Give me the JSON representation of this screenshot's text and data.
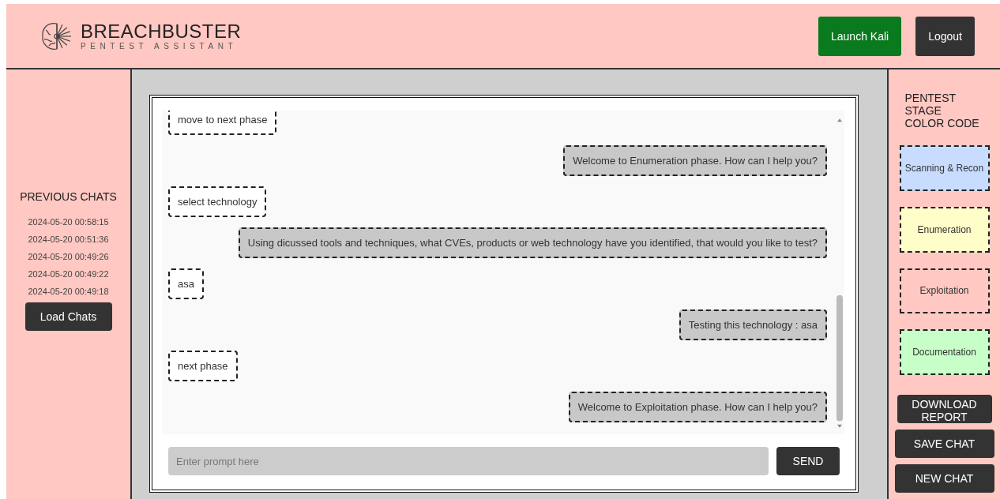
{
  "header": {
    "title": "BREACHBUSTER",
    "subtitle": "PENTEST ASSISTANT",
    "buttons": [
      {
        "label": "Launch Kali",
        "kind": "primary"
      },
      {
        "label": "Logout",
        "kind": "dark"
      }
    ]
  },
  "previous_chats": {
    "title": "PREVIOUS CHATS",
    "items": [
      "2024-05-20 00:58:15",
      "2024-05-20 00:51:36",
      "2024-05-20 00:49:26",
      "2024-05-20 00:49:22",
      "2024-05-20 00:49:18"
    ],
    "button": "Load Chats"
  },
  "chat": {
    "messages": [
      {
        "kind": "user",
        "text": "move to next phase"
      },
      {
        "kind": "bot",
        "text": "Welcome to Enumeration phase. How can I help you?",
        "color": "#c8c8c8"
      },
      {
        "kind": "user",
        "text": "select technology"
      },
      {
        "kind": "bot",
        "text": "Using dicussed tools and techniques, what CVEs, products or web technology have you identified, that would you like to test?",
        "color": "#c8c8c8"
      },
      {
        "kind": "user",
        "text": "asa"
      },
      {
        "kind": "bot",
        "text": "Testing this technology : asa",
        "color": "#c8c8c8"
      },
      {
        "kind": "user",
        "text": "next phase"
      },
      {
        "kind": "bot",
        "text": "Welcome to Exploitation phase. How can I help you?",
        "color": "#c8c8c8"
      }
    ],
    "input": {
      "placeholder": "Enter prompt here"
    },
    "send": "SEND"
  },
  "stages": {
    "title": "PENTEST STAGE COLOR CODE",
    "items": [
      {
        "label": "Scanning & Recon",
        "color": "#c8dcff"
      },
      {
        "label": "Enumeration",
        "color": "#fffdc8"
      },
      {
        "label": "Exploitation",
        "color": "#ffc8c2"
      },
      {
        "label": "Documentation",
        "color": "#c8ffc8"
      }
    ],
    "buttons": [
      "DOWNLOAD REPORT",
      "SAVE CHAT",
      "NEW CHAT"
    ]
  }
}
